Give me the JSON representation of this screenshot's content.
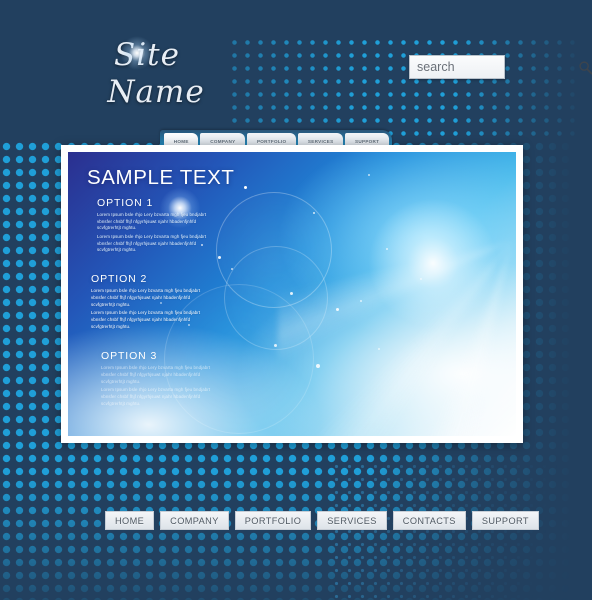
{
  "site": {
    "logo_line1": "Site",
    "logo_line2": "Name",
    "glow_icon": "starburst-glow-icon"
  },
  "search": {
    "value": "search",
    "placeholder": "search",
    "icon": "search-icon"
  },
  "top_nav": {
    "items": [
      {
        "label": "HOME",
        "active": true
      },
      {
        "label": "COMPANY",
        "active": false
      },
      {
        "label": "PORTFOLIO",
        "active": false
      },
      {
        "label": "SERVICES",
        "active": false
      },
      {
        "label": "SUPPORT",
        "active": false
      }
    ]
  },
  "panel": {
    "headline": "SAMPLE TEXT",
    "sections": [
      {
        "title": "OPTION 1",
        "paragraphs": [
          "Lorem Ipsum bsle rhjo Lery bzvarta mgh fjeu bndjabrt vbnsfer chsbf fhjf nfgyrhjsuwt njahr hbadenfjnhfd scvfgtrerhtjt mghtu.",
          "Lorem Ipsum bsle rhjo Lery bzvarta mgh fjeu bndjabrt vbnsfer chsbf fhjf nfgyrhjsuwt njahr hbadenfjnhfd scvfgtrerhtjt mghtu."
        ]
      },
      {
        "title": "OPTION 2",
        "paragraphs": [
          "Lorem Ipsum bsle rhjo Lery bzvarta mgh fjeu bndjabrt vbnsfer chsbf fhjf nfgyrhjsuwt njahr hbadenfjnhfd scvfgtrerhtjt mghtu.",
          "Lorem Ipsum bsle rhjo Lery bzvarta mgh fjeu bndjabrt vbnsfer chsbf fhjf nfgyrhjsuwt njahr hbadenfjnhfd scvfgtrerhtjt mghtu."
        ]
      },
      {
        "title": "OPTION 3",
        "paragraphs": [
          "Lorem Ipsum bsle rhjo Lery bzvarta mgh fjeu bndjabrt vbnsfer chsbf fhjf nfgyrhjsuwt njahr hbadenfjnhfd scvfgtrerhtjt mghtu.",
          "Lorem Ipsum bsle rhjo Lery bzvarta mgh fjeu bndjabrt vbnsfer chsbf fhjf nfgyrhjsuwt njahr hbadenfjnhfd scvfgtrerhtjt mghtu."
        ]
      }
    ]
  },
  "footer_nav": {
    "items": [
      {
        "label": "HOME"
      },
      {
        "label": "COMPANY"
      },
      {
        "label": "PORTFOLIO"
      },
      {
        "label": "SERVICES"
      },
      {
        "label": "CONTACTS"
      },
      {
        "label": "SUPPORT"
      }
    ]
  },
  "colors": {
    "page_background": "#22405f",
    "halftone_dot": "#1f9fd8",
    "panel_frame": "#ffffff",
    "panel_deep_blue": "#2b2f8f",
    "panel_cyan": "#1f8ddb",
    "button_face": "#eef1f4",
    "button_text": "#4e5862",
    "heading_text": "#ffffff"
  }
}
